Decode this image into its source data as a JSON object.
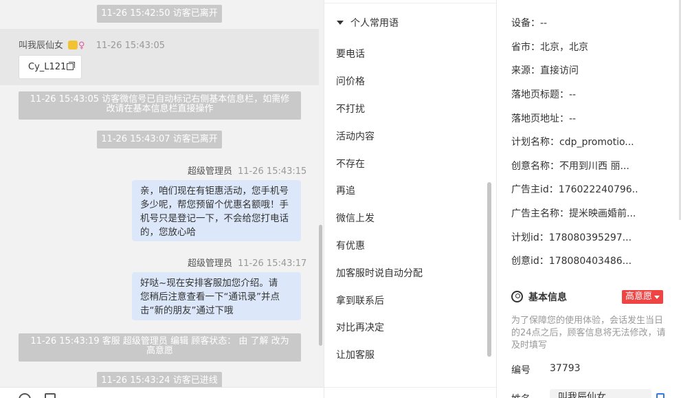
{
  "chat": {
    "sys_left_1": "11-26 15:42:50 访客已离开",
    "visitor_name": "叫我辰仙女",
    "visitor_gender": "♀",
    "visitor_time": "11-26 15:43:05",
    "wechat_chip": "Cy_L121",
    "sys_mark_line1": "11-26 15:43:05 访客微信号已自动标记右侧基本信息栏，如需修",
    "sys_mark_line2": "改请在基本信息栏直接操作",
    "sys_left_2": "11-26 15:43:07 访客已离开",
    "agent_name": "超级管理员",
    "msg1_time": "11-26 15:43:15",
    "msg1_lines": [
      "亲，咱们现在有钜惠活动，您手机号",
      "多少呢，帮您预留个优惠名额哦！手",
      "机号只是登记一下，不会给您打电话",
      "的，您放心哈"
    ],
    "msg2_time": "11-26 15:43:17",
    "msg2_lines": [
      "好哒~现在安排客服加您介绍。请",
      "您稍后注意查看一下“通讯录”并点",
      "击“新的朋友”通过下哦"
    ],
    "sys_edit_line1": "11-26 15:43:19 客服 超级管理员 编辑 顾客状态： 由 了解 改为",
    "sys_edit_line2": "高意愿",
    "sys_enter": "11-26 15:43:24 访客已进线"
  },
  "phrases": {
    "header": "个人常用语",
    "items": [
      "要电话",
      "问价格",
      "不打扰",
      "活动内容",
      "不存在",
      "再追",
      "微信上发",
      "有优惠",
      "加客服时说自动分配",
      "拿到联系后",
      "对比再决定",
      "让加客服"
    ]
  },
  "info": {
    "rows": [
      {
        "label": "设备：",
        "value": "--"
      },
      {
        "label": "省市：",
        "value": "北京，北京"
      },
      {
        "label": "来源：",
        "value": "直接访问"
      },
      {
        "label": "落地页标题：",
        "value": "--"
      },
      {
        "label": "落地页地址：",
        "value": "--"
      },
      {
        "label": "计划名称：",
        "value": "cdp_promotio..."
      },
      {
        "label": "创意名称：",
        "value": "不用到川西 丽..."
      },
      {
        "label": "广告主id：",
        "value": "176022240796..."
      },
      {
        "label": "广告主名称：",
        "value": "提米映画婚前..."
      },
      {
        "label": "计划id：",
        "value": "178080395297..."
      },
      {
        "label": "创意id：",
        "value": "178080403486..."
      }
    ],
    "section_title": "基本信息",
    "intent_badge": "高意愿",
    "note": "为了保障您的使用体验，会话发生当日的24点之后，顾客信息将无法修改，请及时填写",
    "id_label": "编号",
    "id_value": "37793",
    "cut_label": "姓名",
    "cut_value": "叫我辰仙女"
  }
}
